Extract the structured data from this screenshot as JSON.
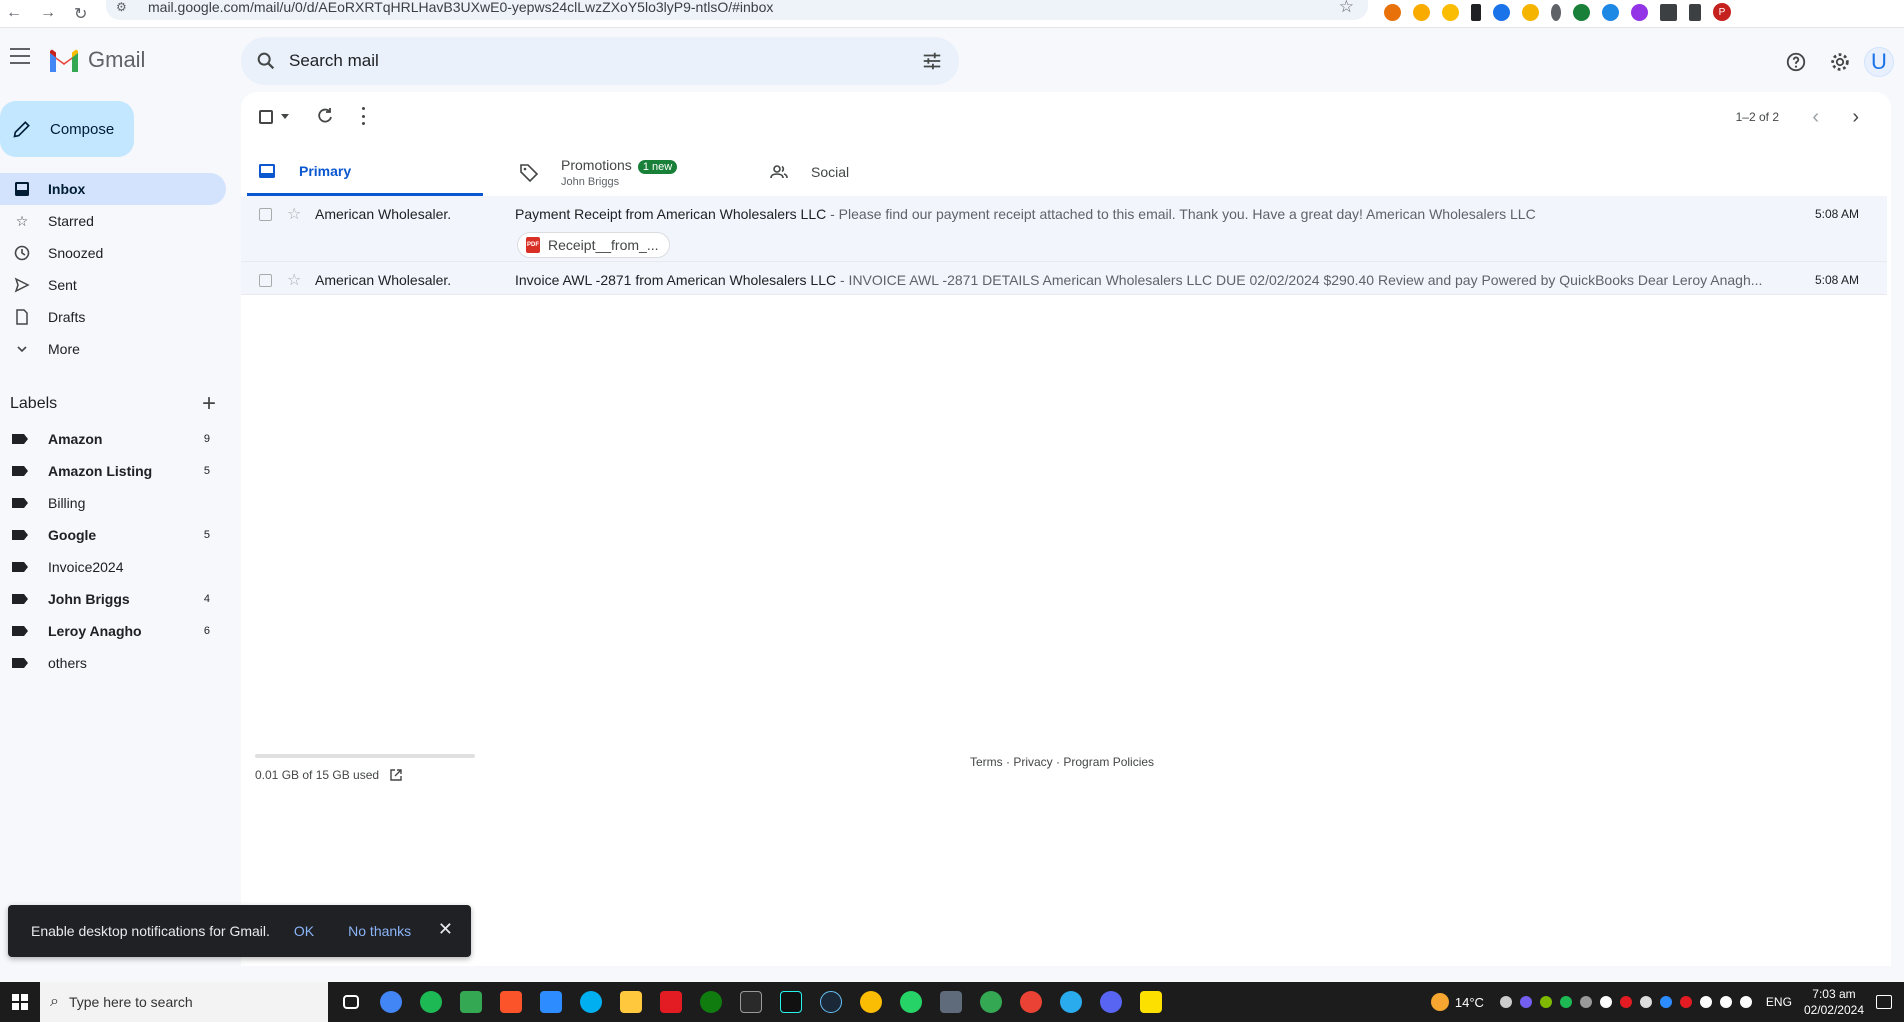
{
  "browser": {
    "url": "mail.google.com/mail/u/0/d/AEoRXRTqHRLHavB3UXwE0-yepws24clLwzZXoY5lo3lyP9-ntlsO/#inbox",
    "profile_initial": "P"
  },
  "header": {
    "brand": "Gmail",
    "search_placeholder": "Search mail",
    "avatar_initial": "U"
  },
  "sidebar": {
    "compose_label": "Compose",
    "items": [
      {
        "label": "Inbox",
        "icon": "inbox-icon",
        "active": true
      },
      {
        "label": "Starred",
        "icon": "star-icon"
      },
      {
        "label": "Snoozed",
        "icon": "clock-icon"
      },
      {
        "label": "Sent",
        "icon": "send-icon"
      },
      {
        "label": "Drafts",
        "icon": "draft-icon"
      },
      {
        "label": "More",
        "icon": "chevron-down-icon"
      }
    ],
    "labels_title": "Labels",
    "labels": [
      {
        "name": "Amazon",
        "count": "9",
        "bold": true
      },
      {
        "name": "Amazon Listing",
        "count": "5",
        "bold": true
      },
      {
        "name": "Billing",
        "count": "",
        "bold": false
      },
      {
        "name": "Google",
        "count": "5",
        "bold": true
      },
      {
        "name": "Invoice2024",
        "count": "",
        "bold": false
      },
      {
        "name": "John Briggs",
        "count": "4",
        "bold": true
      },
      {
        "name": "Leroy Anagho",
        "count": "6",
        "bold": true
      },
      {
        "name": "others",
        "count": "",
        "bold": false
      }
    ]
  },
  "toolbar": {
    "pager_text": "1–2 of 2"
  },
  "tabs": {
    "primary": "Primary",
    "promotions": "Promotions",
    "promotions_badge": "1 new",
    "promotions_sub": "John Briggs",
    "social": "Social"
  },
  "emails": [
    {
      "sender": "American Wholesaler.",
      "subject": "Payment Receipt from American Wholesalers LLC",
      "snippet": " - Please find our payment receipt attached to this email. Thank you. Have a great day! American Wholesalers LLC",
      "time": "5:08 AM",
      "attachment": "Receipt__from_..."
    },
    {
      "sender": "American Wholesaler.",
      "subject": "Invoice AWL -2871 from American Wholesalers LLC",
      "snippet": " - INVOICE AWL -2871 DETAILS American Wholesalers LLC DUE 02/02/2024 $290.40 Review and pay Powered by QuickBooks Dear Leroy Anagh...",
      "time": "5:08 AM"
    }
  ],
  "storage": {
    "text": "0.01 GB of 15 GB used"
  },
  "footer": {
    "terms": "Terms",
    "sep1": " · ",
    "privacy": "Privacy",
    "sep2": " · ",
    "policies": "Program Policies"
  },
  "toast": {
    "message": "Enable desktop notifications for Gmail.",
    "ok": "OK",
    "no_thanks": "No thanks"
  },
  "taskbar": {
    "search_placeholder": "Type here to search",
    "temperature": "14°C",
    "language": "ENG",
    "time": "7:03 am",
    "date": "02/02/2024"
  }
}
